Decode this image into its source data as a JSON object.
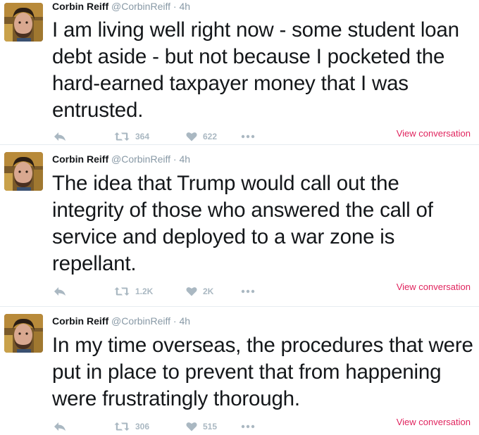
{
  "tweets": [
    {
      "name": "Corbin Reiff",
      "handle": "@CorbinReiff",
      "dot": "·",
      "time": "4h",
      "text": "I am living well right now - some student loan debt aside - but not because I pocketed the hard-earned taxpayer money that I was entrusted.",
      "retweets": "364",
      "likes": "622",
      "view_conversation": "View conversation"
    },
    {
      "name": "Corbin Reiff",
      "handle": "@CorbinReiff",
      "dot": "·",
      "time": "4h",
      "text": "The idea that Trump would call out the integrity of those who answered the call of service and deployed to a war zone is repellant.",
      "retweets": "1.2K",
      "likes": "2K",
      "view_conversation": "View conversation"
    },
    {
      "name": "Corbin Reiff",
      "handle": "@CorbinReiff",
      "dot": "·",
      "time": "4h",
      "text": "In my time overseas, the procedures that were put in place to prevent that from happening were frustratingly thorough.",
      "retweets": "306",
      "likes": "515",
      "view_conversation": "View conversation"
    }
  ],
  "icons": {
    "reply": "reply-icon",
    "retweet": "retweet-icon",
    "like": "heart-icon",
    "more": "more-icon"
  },
  "colors": {
    "action_gray": "#aab8c2",
    "link_red": "#e0245e",
    "meta_gray": "#8899a6",
    "text": "#14171a"
  }
}
